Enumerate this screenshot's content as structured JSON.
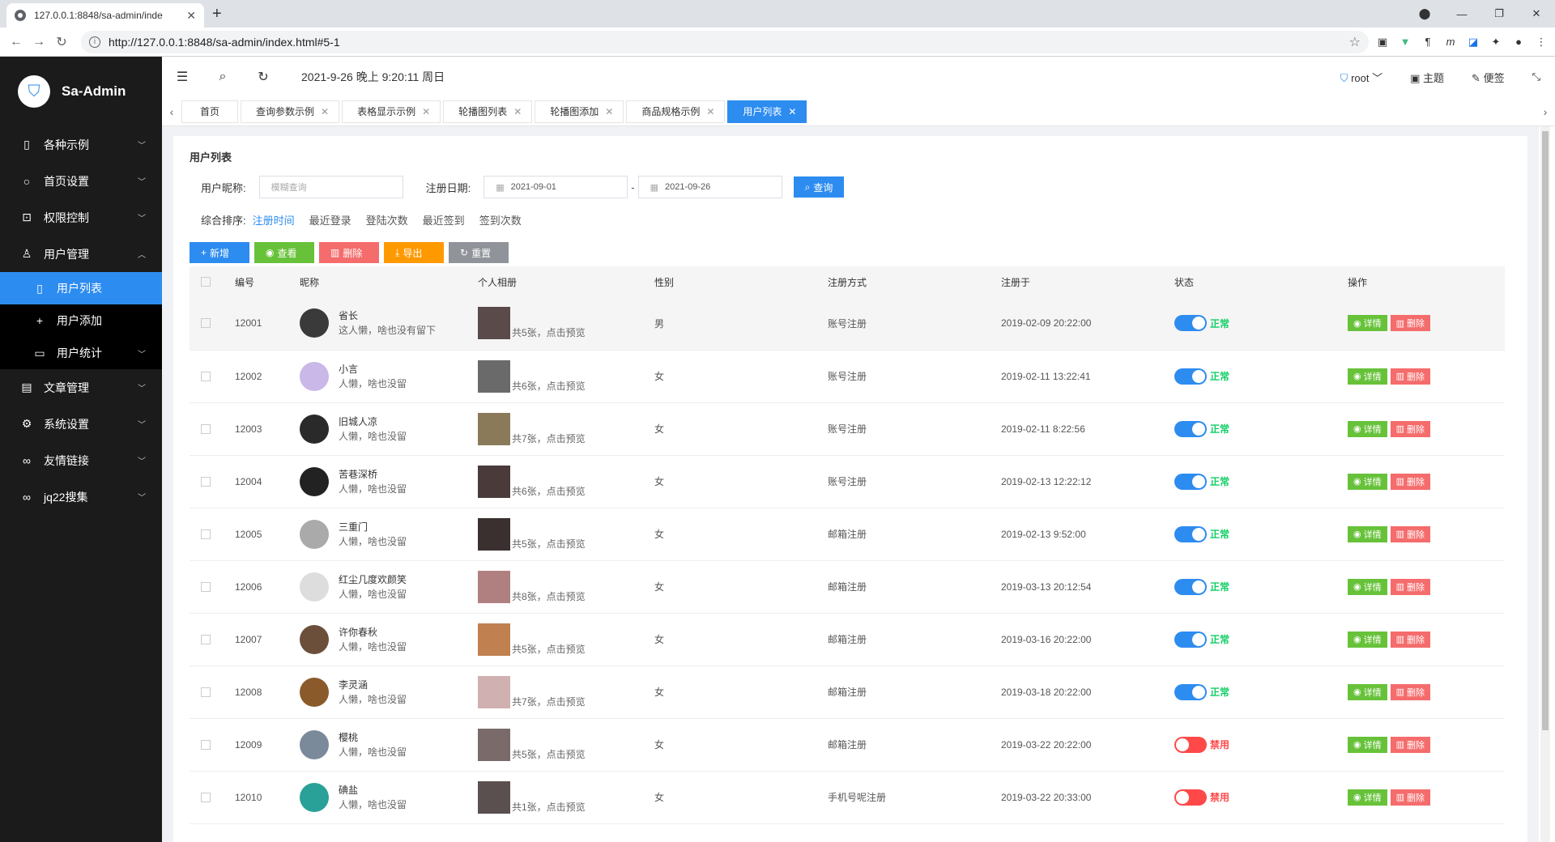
{
  "browser": {
    "tab_title": "127.0.0.1:8848/sa-admin/inde",
    "url": "http://127.0.0.1:8848/sa-admin/index.html#5-1"
  },
  "sidebar": {
    "app_name": "Sa-Admin",
    "items": [
      {
        "label": "各种示例",
        "icon": "file-icon"
      },
      {
        "label": "首页设置",
        "icon": "search-icon"
      },
      {
        "label": "权限控制",
        "icon": "lock-icon"
      },
      {
        "label": "用户管理",
        "icon": "user-icon"
      },
      {
        "label": "文章管理",
        "icon": "article-icon"
      },
      {
        "label": "系统设置",
        "icon": "gear-icon"
      },
      {
        "label": "友情链接",
        "icon": "link-icon"
      },
      {
        "label": "jq22搜集",
        "icon": "link-icon"
      }
    ],
    "sub_items": [
      {
        "label": "用户列表"
      },
      {
        "label": "用户添加"
      },
      {
        "label": "用户统计"
      }
    ]
  },
  "topbar": {
    "datetime": "2021-9-26 晚上 9:20:11 周日",
    "user": "root",
    "theme": "主题",
    "note": "便签"
  },
  "tabs": [
    "首页",
    "查询参数示例",
    "表格显示示例",
    "轮播图列表",
    "轮播图添加",
    "商品规格示例",
    "用户列表"
  ],
  "page": {
    "title": "用户列表",
    "nickname_label": "用户昵称:",
    "nickname_placeholder": "模糊查询",
    "date_label": "注册日期:",
    "date_from": "2021-09-01",
    "date_sep": "-",
    "date_to": "2021-09-26",
    "query_btn": "查询",
    "sort_label": "综合排序:",
    "sorts": [
      "注册时间",
      "最近登录",
      "登陆次数",
      "最近签到",
      "签到次数"
    ],
    "buttons": {
      "add": "新增",
      "view": "查看",
      "del": "删除",
      "export": "导出",
      "reset": "重置"
    }
  },
  "table": {
    "headers": [
      "编号",
      "昵称",
      "个人相册",
      "性别",
      "注册方式",
      "注册于",
      "状态",
      "操作"
    ],
    "detail_label": "详情",
    "delete_label": "删除",
    "rows": [
      {
        "id": "12001",
        "name": "省长",
        "desc": "这人懒，啥也没有留下",
        "album": "共5张，点击预览",
        "gender": "男",
        "reg": "账号注册",
        "date": "2019-02-09 20:22:00",
        "status": "正常",
        "on": true
      },
      {
        "id": "12002",
        "name": "小言",
        "desc": "人懒，啥也没留",
        "album": "共6张，点击预览",
        "gender": "女",
        "reg": "账号注册",
        "date": "2019-02-11 13:22:41",
        "status": "正常",
        "on": true
      },
      {
        "id": "12003",
        "name": "旧城人凉",
        "desc": "人懒，啥也没留",
        "album": "共7张，点击预览",
        "gender": "女",
        "reg": "账号注册",
        "date": "2019-02-11 8:22:56",
        "status": "正常",
        "on": true
      },
      {
        "id": "12004",
        "name": "苦巷深桥",
        "desc": "人懒，啥也没留",
        "album": "共6张，点击预览",
        "gender": "女",
        "reg": "账号注册",
        "date": "2019-02-13 12:22:12",
        "status": "正常",
        "on": true
      },
      {
        "id": "12005",
        "name": "三重门",
        "desc": "人懒，啥也没留",
        "album": "共5张，点击预览",
        "gender": "女",
        "reg": "邮箱注册",
        "date": "2019-02-13 9:52:00",
        "status": "正常",
        "on": true
      },
      {
        "id": "12006",
        "name": "红尘几度欢颜笑",
        "desc": "人懒，啥也没留",
        "album": "共8张，点击预览",
        "gender": "女",
        "reg": "邮箱注册",
        "date": "2019-03-13 20:12:54",
        "status": "正常",
        "on": true
      },
      {
        "id": "12007",
        "name": "许你春秋",
        "desc": "人懒，啥也没留",
        "album": "共5张，点击预览",
        "gender": "女",
        "reg": "邮箱注册",
        "date": "2019-03-16 20:22:00",
        "status": "正常",
        "on": true
      },
      {
        "id": "12008",
        "name": "李灵涵",
        "desc": "人懒，啥也没留",
        "album": "共7张，点击预览",
        "gender": "女",
        "reg": "邮箱注册",
        "date": "2019-03-18 20:22:00",
        "status": "正常",
        "on": true
      },
      {
        "id": "12009",
        "name": "樱桃",
        "desc": "人懒，啥也没留",
        "album": "共5张，点击预览",
        "gender": "女",
        "reg": "邮箱注册",
        "date": "2019-03-22 20:22:00",
        "status": "禁用",
        "on": false
      },
      {
        "id": "12010",
        "name": "碘盐",
        "desc": "人懒，啥也没留",
        "album": "共1张，点击预览",
        "gender": "女",
        "reg": "手机号呢注册",
        "date": "2019-03-22 20:33:00",
        "status": "禁用",
        "on": false
      }
    ]
  }
}
